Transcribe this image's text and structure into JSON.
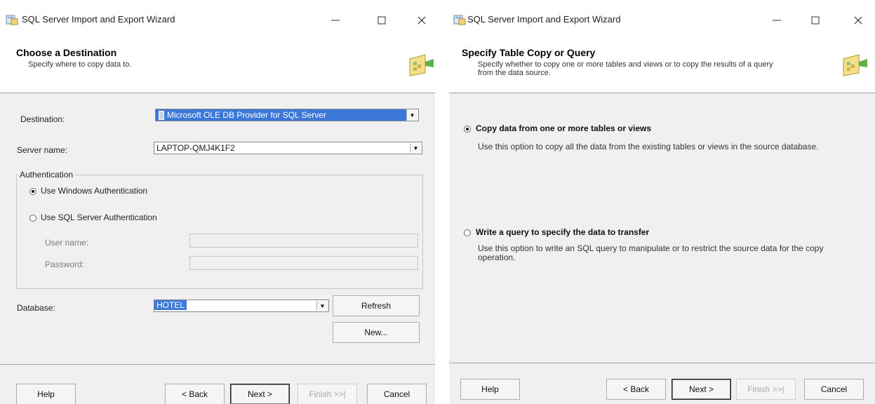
{
  "left_window": {
    "title": "SQL Server Import and Export Wizard",
    "header": {
      "title": "Choose a Destination",
      "subtitle": "Specify where to copy data to."
    },
    "destination": {
      "label": "Destination:",
      "value": "Microsoft OLE DB Provider for SQL Server"
    },
    "server": {
      "label": "Server name:",
      "value": "LAPTOP-QMJ4K1F2"
    },
    "authentication": {
      "legend": "Authentication",
      "windows_label": "Use Windows Authentication",
      "sql_label": "Use SQL Server Authentication",
      "username_label": "User name:",
      "password_label": "Password:",
      "selected": "windows"
    },
    "database": {
      "label": "Database:",
      "value": "HOTEL",
      "refresh_label": "Refresh",
      "new_label": "New..."
    },
    "footer": {
      "help": "Help",
      "back": "< Back",
      "next": "Next >",
      "finish": "Finish >>|",
      "cancel": "Cancel"
    }
  },
  "right_window": {
    "title": "SQL Server Import and Export Wizard",
    "header": {
      "title": "Specify Table Copy or Query",
      "subtitle_line1": "Specify whether to copy one or more tables and views or to copy the results of a query",
      "subtitle_line2": "from the data source."
    },
    "option_copy": {
      "label": "Copy data from one or more tables or views",
      "description": "Use this option to copy all the data from the existing tables or views in the source database.",
      "selected": true
    },
    "option_query": {
      "label": "Write a query to specify the data to transfer",
      "description_line1": "Use this option to write an SQL query to manipulate or to restrict the source data for the copy",
      "description_line2": "operation.",
      "selected": false
    },
    "footer": {
      "help": "Help",
      "back": "< Back",
      "next": "Next >",
      "finish": "Finish >>|",
      "cancel": "Cancel"
    }
  },
  "icons": {
    "app": "wizard-app-icon",
    "header": "import-export-header-icon",
    "minimize": "minimize-icon",
    "maximize": "maximize-icon",
    "close": "close-icon",
    "dropdown": "chevron-down-icon"
  },
  "colors": {
    "window_bg": "#f0f0f0",
    "header_bg": "#ffffff",
    "selection": "#3b78d8",
    "border": "#828790"
  }
}
